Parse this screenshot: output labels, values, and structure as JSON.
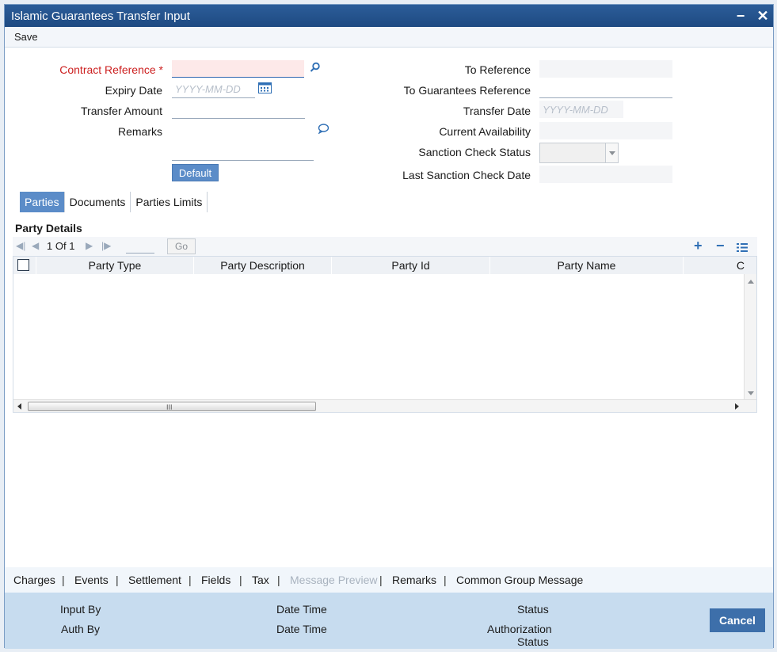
{
  "window": {
    "title": "Islamic Guarantees Transfer Input",
    "minimize_glyph": "−",
    "close_glyph": "✕"
  },
  "toolbar": {
    "save_label": "Save"
  },
  "form": {
    "contract_reference": {
      "label": "Contract Reference",
      "required_mark": "*",
      "value": ""
    },
    "expiry_date": {
      "label": "Expiry Date",
      "placeholder": "YYYY-MM-DD"
    },
    "transfer_amount": {
      "label": "Transfer Amount",
      "value": ""
    },
    "remarks": {
      "label": "Remarks",
      "value": ""
    },
    "default_button": "Default",
    "to_reference": {
      "label": "To Reference",
      "value": ""
    },
    "to_guarantees_reference": {
      "label": "To Guarantees Reference",
      "value": ""
    },
    "transfer_date": {
      "label": "Transfer Date",
      "placeholder": "YYYY-MM-DD"
    },
    "current_availability": {
      "label": "Current Availability",
      "value": ""
    },
    "sanction_check_status": {
      "label": "Sanction Check Status",
      "selected": ""
    },
    "last_sanction_check_date": {
      "label": "Last Sanction Check Date",
      "value": ""
    }
  },
  "tabs": [
    "Parties",
    "Documents",
    "Parties Limits"
  ],
  "active_tab": "Parties",
  "party_details": {
    "title": "Party Details",
    "pager": {
      "current": "1",
      "of_label": "Of",
      "total": "1",
      "go_label": "Go"
    },
    "columns": [
      "Party Type",
      "Party Description",
      "Party Id",
      "Party Name",
      "C"
    ],
    "rows": []
  },
  "bottom_links": [
    "Charges",
    "Events",
    "Settlement",
    "Fields",
    "Tax",
    "Message Preview",
    "Remarks",
    "Common Group Message"
  ],
  "disabled_links": [
    "Message Preview"
  ],
  "footer": {
    "input_by": "Input By",
    "auth_by": "Auth By",
    "date_time_1": "Date Time",
    "date_time_2": "Date Time",
    "status": "Status",
    "authorization_status_line1": "Authorization",
    "authorization_status_line2": "Status",
    "cancel_label": "Cancel"
  },
  "icons": {
    "search": "search-icon",
    "calendar": "calendar-icon",
    "remarks": "speech-bubble-icon",
    "add": "plus-icon",
    "delete": "minus-icon",
    "details": "list-icon"
  },
  "colors": {
    "title_bar": "#1e4a82",
    "accent": "#5b8cc8",
    "required": "#cc1f1f",
    "footer": "#c7dcef",
    "cancel": "#3d6faa"
  }
}
